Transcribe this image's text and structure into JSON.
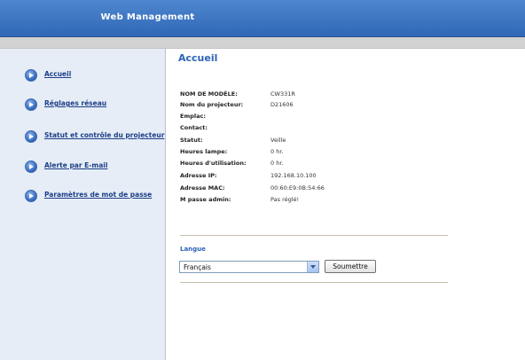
{
  "header": {
    "title": "Web Management"
  },
  "sidebar": {
    "items": [
      {
        "label": "Accueil"
      },
      {
        "label": "Réglages réseau"
      },
      {
        "label": "Statut et contrôle du projecteur"
      },
      {
        "label": "Alerte par E-mail"
      },
      {
        "label": "Paramètres de mot de passe"
      }
    ]
  },
  "main": {
    "title": "Accueil",
    "info": [
      {
        "label": "NOM DE MODÈLE:",
        "value": "CW331R"
      },
      {
        "label": "Nom du projecteur:",
        "value": "D21606"
      },
      {
        "label": "Emplac:",
        "value": ""
      },
      {
        "label": "Contact:",
        "value": ""
      },
      {
        "label": "Statut:",
        "value": "Veille"
      },
      {
        "label": "Heures lampe:",
        "value": "0 hr."
      },
      {
        "label": "Heures d'utilisation:",
        "value": "0 hr."
      },
      {
        "label": "Adresse IP:",
        "value": "192.168.10.100"
      },
      {
        "label": "Adresse MAC:",
        "value": "00:60:E9:0B:54:66"
      },
      {
        "label": "M passe admin:",
        "value": "Pas réglé!"
      }
    ],
    "language": {
      "title": "Langue",
      "selected": "Français",
      "submit_label": "Soumettre"
    }
  },
  "colors": {
    "header_blue": "#3a74c4",
    "sidebar_bg": "#e6edf7",
    "accent_blue": "#2c63b8",
    "link_blue": "#1c3f86"
  },
  "icons": [
    "arrow-circle-icon",
    "dropdown-arrow-icon"
  ]
}
